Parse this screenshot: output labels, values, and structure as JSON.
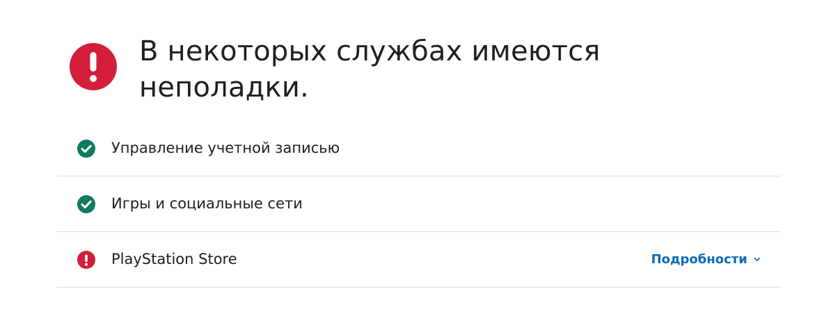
{
  "header": {
    "headline": "В некоторых службах имеются неполадки.",
    "icon": "exclamation-circle-icon",
    "icon_color": "#d31f3b"
  },
  "services": [
    {
      "label": "Управление учетной записью",
      "status": "ok",
      "icon": "check-circle-icon"
    },
    {
      "label": "Игры и социальные сети",
      "status": "ok",
      "icon": "check-circle-icon"
    },
    {
      "label": "PlayStation Store",
      "status": "issue",
      "icon": "exclamation-circle-icon",
      "details_label": "Подробности",
      "details_icon": "chevron-down-icon"
    }
  ],
  "colors": {
    "ok": "#0f7a5e",
    "issue": "#d31f3b",
    "link": "#0a6bb8",
    "divider": "#dcdcdc",
    "text": "#1f1f1f"
  }
}
